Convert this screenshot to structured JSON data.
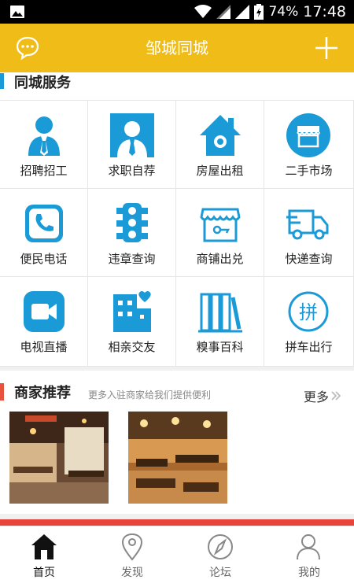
{
  "status_bar": {
    "battery": "74%",
    "time": "17:48"
  },
  "header": {
    "title": "邹城同城"
  },
  "services": {
    "title": "同城服务",
    "items": [
      {
        "label": "招聘招工",
        "icon": "recruit-person-icon"
      },
      {
        "label": "求职自荐",
        "icon": "job-seeker-icon"
      },
      {
        "label": "房屋出租",
        "icon": "house-icon"
      },
      {
        "label": "二手市场",
        "icon": "shop-awning-icon"
      },
      {
        "label": "便民电话",
        "icon": "phone-icon"
      },
      {
        "label": "违章查询",
        "icon": "traffic-light-icon"
      },
      {
        "label": "商铺出兑",
        "icon": "store-icon"
      },
      {
        "label": "快递查询",
        "icon": "delivery-truck-icon"
      },
      {
        "label": "电视直播",
        "icon": "video-camera-icon"
      },
      {
        "label": "相亲交友",
        "icon": "building-heart-icon"
      },
      {
        "label": "糗事百科",
        "icon": "books-icon"
      },
      {
        "label": "拼车出行",
        "icon": "carpool-pin-icon"
      }
    ]
  },
  "merchants": {
    "title": "商家推荐",
    "subtitle": "更多入驻商家给我们提供便利",
    "more_label": "更多"
  },
  "tabbar": {
    "tabs": [
      {
        "label": "首页",
        "icon": "home-icon"
      },
      {
        "label": "发现",
        "icon": "map-pin-icon"
      },
      {
        "label": "论坛",
        "icon": "compass-icon"
      },
      {
        "label": "我的",
        "icon": "profile-icon"
      }
    ]
  },
  "colors": {
    "accent": "#f0bd18",
    "icon_blue": "#1a9ad6",
    "merchant_bar": "#e9513f",
    "strip": "#e8443a"
  }
}
